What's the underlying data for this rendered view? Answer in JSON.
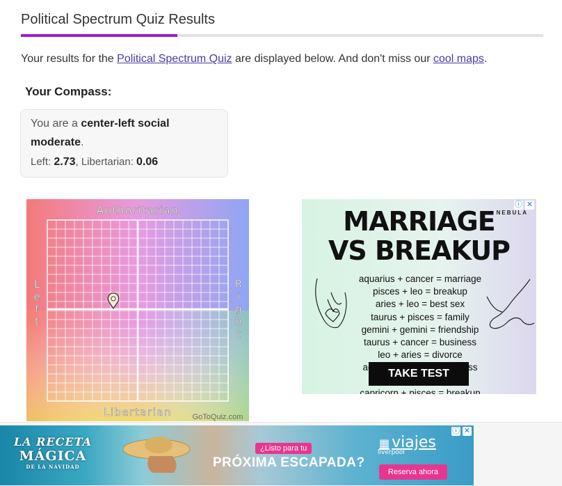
{
  "page": {
    "title": "Political Spectrum Quiz Results",
    "intro_prefix": "Your results for the ",
    "intro_link1": "Political Spectrum Quiz",
    "intro_middle": " are displayed below. And don't miss our ",
    "intro_link2": "cool maps",
    "intro_suffix": ".",
    "accent_color": "#9b19d8"
  },
  "compass": {
    "heading": "Your Compass:",
    "line1_prefix": "You are a ",
    "line1_bold": "center-left social",
    "line2_bold": "moderate",
    "line2_suffix": ".",
    "left_label": "Left: ",
    "left_value": "2.73",
    "lib_label": ", Libertarian: ",
    "lib_value": "0.06",
    "axis_top": "Authoritarian",
    "axis_bottom": "Libertarian",
    "axis_left": "Left",
    "axis_right": "Right",
    "watermark": "GoToQuiz.com",
    "marker_icon": "map-pin-icon"
  },
  "ad_right": {
    "brand": "NEBULA",
    "headline1": "MARRIAGE",
    "headline2": "VS BREAKUP",
    "lines": [
      "aquarius + cancer = marriage",
      "pisces + leo = breakup",
      "aries + leo = best sex",
      "taurus + pisces = family",
      "gemini + gemini = friendship",
      "taurus + cancer = business",
      "leo + aries = divorce",
      "aquarius + aries = business",
      "pisces + aries = sex",
      "capricorn + pisces = breakup"
    ],
    "cta": "TAKE TEST",
    "info_icon": "ⓘ",
    "close_icon": "✕"
  },
  "ad_bottom": {
    "logo_line1": "LA RECETA",
    "logo_line2": "MÁGICA",
    "logo_line3": "DE LA NAVIDAD",
    "tag": "¿Listo para tu",
    "headline": "PRÓXIMA ESCAPADA?",
    "brand": "viajes",
    "brand_small": "liverpool",
    "cta": "Reserva ahora",
    "info_icon": "ⓘ",
    "close_icon": "✕"
  }
}
